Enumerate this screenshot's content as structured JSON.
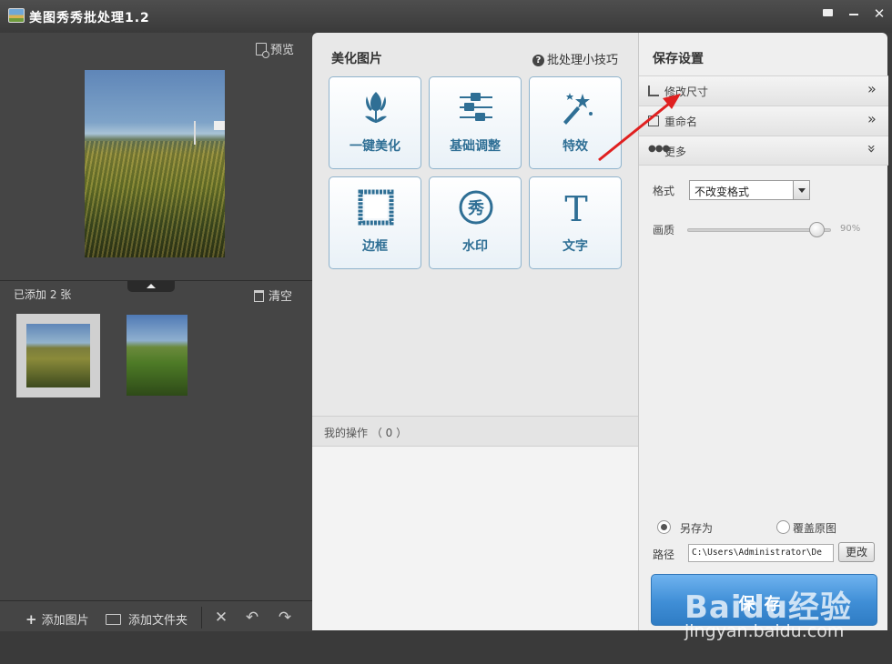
{
  "window": {
    "title": "美图秀秀批处理1.2",
    "controls": [
      "feedback-icon",
      "minimize-icon",
      "close-icon"
    ],
    "close_glyph": "✕"
  },
  "left": {
    "preview_label": "预览",
    "added_count": "已添加 2 张",
    "clear_label": "清空",
    "footer": {
      "add_image": "添加图片",
      "add_folder": "添加文件夹",
      "delete_glyph": "✕",
      "undo_glyph": "↶",
      "redo_glyph": "↷"
    }
  },
  "center": {
    "title": "美化图片",
    "tips_label": "批处理小技巧",
    "tools": [
      {
        "label": "一键美化",
        "icon": "tulip-icon"
      },
      {
        "label": "基础调整",
        "icon": "sliders-icon"
      },
      {
        "label": "特效",
        "icon": "magic-wand-icon"
      },
      {
        "label": "边框",
        "icon": "frame-icon"
      },
      {
        "label": "水印",
        "icon": "watermark-stamp-icon"
      },
      {
        "label": "文字",
        "icon": "text-t-icon"
      }
    ],
    "watermark_stamp_char": "秀",
    "text_glyph": "T",
    "operations_label": "我的操作 （ 0 ）"
  },
  "right": {
    "title": "保存设置",
    "sections": [
      {
        "label": "修改尺寸",
        "icon": "crop-icon"
      },
      {
        "label": "重命名",
        "icon": "rename-icon"
      },
      {
        "label": "更多",
        "icon": "dots-icon"
      }
    ],
    "format_label": "格式",
    "format_value": "不改变格式",
    "quality_label": "画质",
    "quality_value": "90%",
    "quality_fraction": 0.9,
    "save_as_label": "另存为",
    "overwrite_label": "覆盖原图",
    "save_mode": "另存为",
    "path_label": "路径",
    "path_value": "C:\\Users\\Administrator\\De",
    "change_label": "更改",
    "save_label": "保存"
  },
  "watermark": {
    "brand": "Baidu经验",
    "url": "jingyan.baidu.com"
  },
  "colors": {
    "accent": "#3f8ed6",
    "tool_label": "#2f6f95",
    "annotation": "#e02020"
  }
}
